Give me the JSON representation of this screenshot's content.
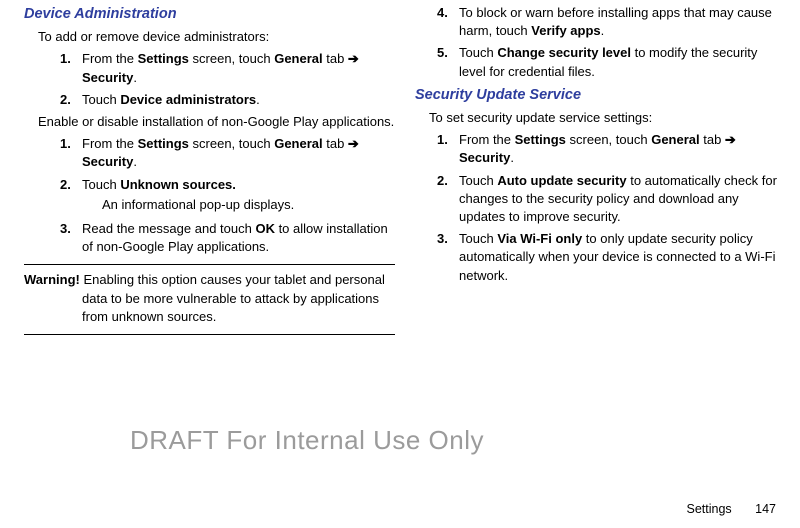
{
  "left": {
    "heading": "Device Administration",
    "intro": "To add or remove device administrators:",
    "list1": [
      {
        "num": "1.",
        "pre": "From the ",
        "b1": "Settings",
        "mid": " screen, touch ",
        "b2": "General",
        "post": " tab ",
        "arrow": "➔",
        "br": true,
        "b3": "Security",
        "tail": "."
      },
      {
        "num": "2.",
        "pre": "Touch ",
        "b1": "Device administrators",
        "tail": "."
      }
    ],
    "intro2": "Enable or disable installation of non-Google Play applications.",
    "list2": [
      {
        "num": "1.",
        "pre": "From the ",
        "b1": "Settings",
        "mid": " screen, touch ",
        "b2": "General",
        "post": " tab ",
        "arrow": "➔",
        "br": true,
        "b3": "Security",
        "tail": "."
      },
      {
        "num": "2.",
        "pre": "Touch ",
        "b1": "Unknown sources.",
        "sub": "An informational pop-up displays."
      },
      {
        "num": "3.",
        "pre": "Read the message and touch ",
        "b1": "OK",
        "tail": " to allow installation of non-Google Play applications."
      }
    ],
    "warnLabel": "Warning!",
    "warnBody": "Enabling this option causes your tablet and personal data to be more vulnerable to attack by applications from unknown sources."
  },
  "right": {
    "list1": [
      {
        "num": "4.",
        "pre": "To block or warn before installing apps that may cause harm, touch ",
        "b1": "Verify apps",
        "tail": "."
      },
      {
        "num": "5.",
        "pre": "Touch ",
        "b1": "Change security level",
        "tail": " to modify the security level for credential files."
      }
    ],
    "heading": "Security Update Service",
    "intro": "To set security update service settings:",
    "list2": [
      {
        "num": "1.",
        "pre": "From the ",
        "b1": "Settings",
        "mid": " screen, touch ",
        "b2": "General",
        "post": " tab ",
        "arrow": "➔",
        "br": true,
        "b3": "Security",
        "tail": "."
      },
      {
        "num": "2.",
        "pre": "Touch ",
        "b1": "Auto update security",
        "tail": " to automatically check for changes to the security policy and download any updates to improve security."
      },
      {
        "num": "3.",
        "pre": "Touch ",
        "b1": "Via Wi-Fi only",
        "tail": " to only update security policy automatically when your device is connected to a Wi-Fi network."
      }
    ]
  },
  "watermark": "DRAFT For Internal Use Only",
  "footer": {
    "label": "Settings",
    "page": "147"
  }
}
